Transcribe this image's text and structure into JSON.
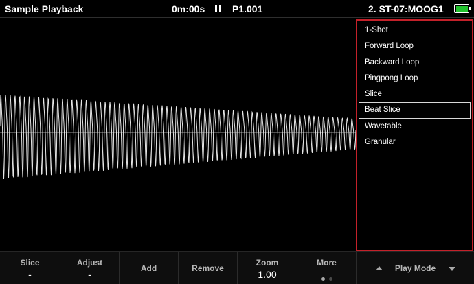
{
  "header": {
    "title": "Sample Playback",
    "time": "0m:00s",
    "pattern": "P1.001",
    "track": "2. ST-07:MOOG1",
    "battery_level": 1.0,
    "battery_color": "#22c22e"
  },
  "menu": {
    "border_color": "#c4212a",
    "selected": "Beat Slice",
    "items": [
      {
        "label": "1-Shot"
      },
      {
        "label": "Forward Loop"
      },
      {
        "label": "Backward Loop"
      },
      {
        "label": "Pingpong Loop"
      },
      {
        "label": "Slice"
      },
      {
        "label": "Beat Slice"
      },
      {
        "label": "Wavetable"
      },
      {
        "label": "Granular"
      }
    ]
  },
  "toolbar": {
    "slice": {
      "label": "Slice",
      "value": "-"
    },
    "adjust": {
      "label": "Adjust",
      "value": "-"
    },
    "add": {
      "label": "Add"
    },
    "remove": {
      "label": "Remove"
    },
    "zoom": {
      "label": "Zoom",
      "value": "1.00"
    },
    "more": {
      "label": "More",
      "page": 1,
      "pages": 2
    },
    "play_mode": {
      "label": "Play Mode"
    }
  }
}
